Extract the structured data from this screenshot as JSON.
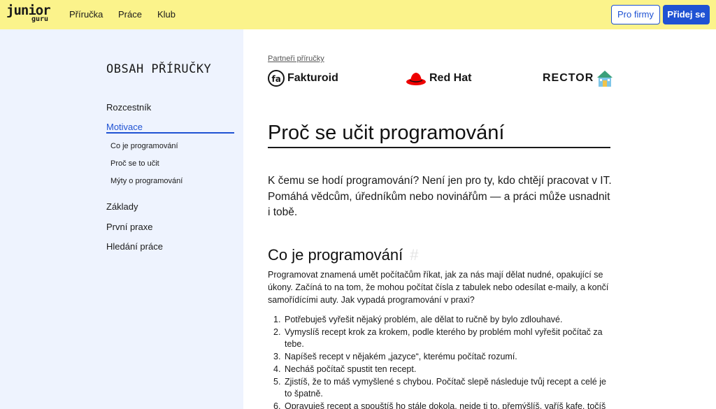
{
  "header": {
    "logo_main": "junior",
    "logo_sub": "guru",
    "nav": [
      "Příručka",
      "Práce",
      "Klub"
    ],
    "btn_firms": "Pro firmy",
    "btn_join": "Přidej se",
    "colors": {
      "bar": "#fbf38b",
      "accent": "#1f52d3"
    }
  },
  "sidebar": {
    "title": "OBSAH PŘÍRUČKY",
    "items": [
      "Rozcestník",
      "Motivace",
      "Základy",
      "První praxe",
      "Hledání práce"
    ],
    "active": "Motivace",
    "subitems": [
      "Co je programování",
      "Proč se to učit",
      "Mýty o programování"
    ]
  },
  "main": {
    "partners_label": "Partneři příručky",
    "partners": [
      "Fakturoid",
      "Red Hat",
      "RECTOR"
    ],
    "h1": "Proč se učit programování",
    "lead": "K čemu se hodí programování? Není jen pro ty, kdo chtějí pracovat v IT. Pomáhá vědcům, úředníkům nebo novinářům — a práci může usnadnit i tobě.",
    "h2": "Co je programování",
    "h2_anchor": "#",
    "para": "Programovat znamená umět počítačům říkat, jak za nás mají dělat nudné, opakující se úkony. Začíná to na tom, že mohou počítat čísla z tabulek nebo odesílat e-maily, a končí samořídícími auty. Jak vypadá programování v praxi?",
    "steps": [
      "Potřebuješ vyřešit nějaký problém, ale dělat to ručně by bylo zdlouhavé.",
      "Vymyslíš recept krok za krokem, podle kterého by problém mohl vyřešit počítač za tebe.",
      "Napíšeš recept v nějakém „jazyce“, kterému počítač rozumí.",
      "Necháš počítač spustit ten recept.",
      "Zjistíš, že to máš vymyšlené s chybou. Počítač slepě následuje tvůj recept a celé je to špatně.",
      "Opravuješ recept a spouštíš ho stále dokola, nejde ti to, přemýšlíš, vaříš kafe, točíš"
    ],
    "step_numbers": [
      "1.",
      "2.",
      "3.",
      "4.",
      "5.",
      "6."
    ]
  }
}
